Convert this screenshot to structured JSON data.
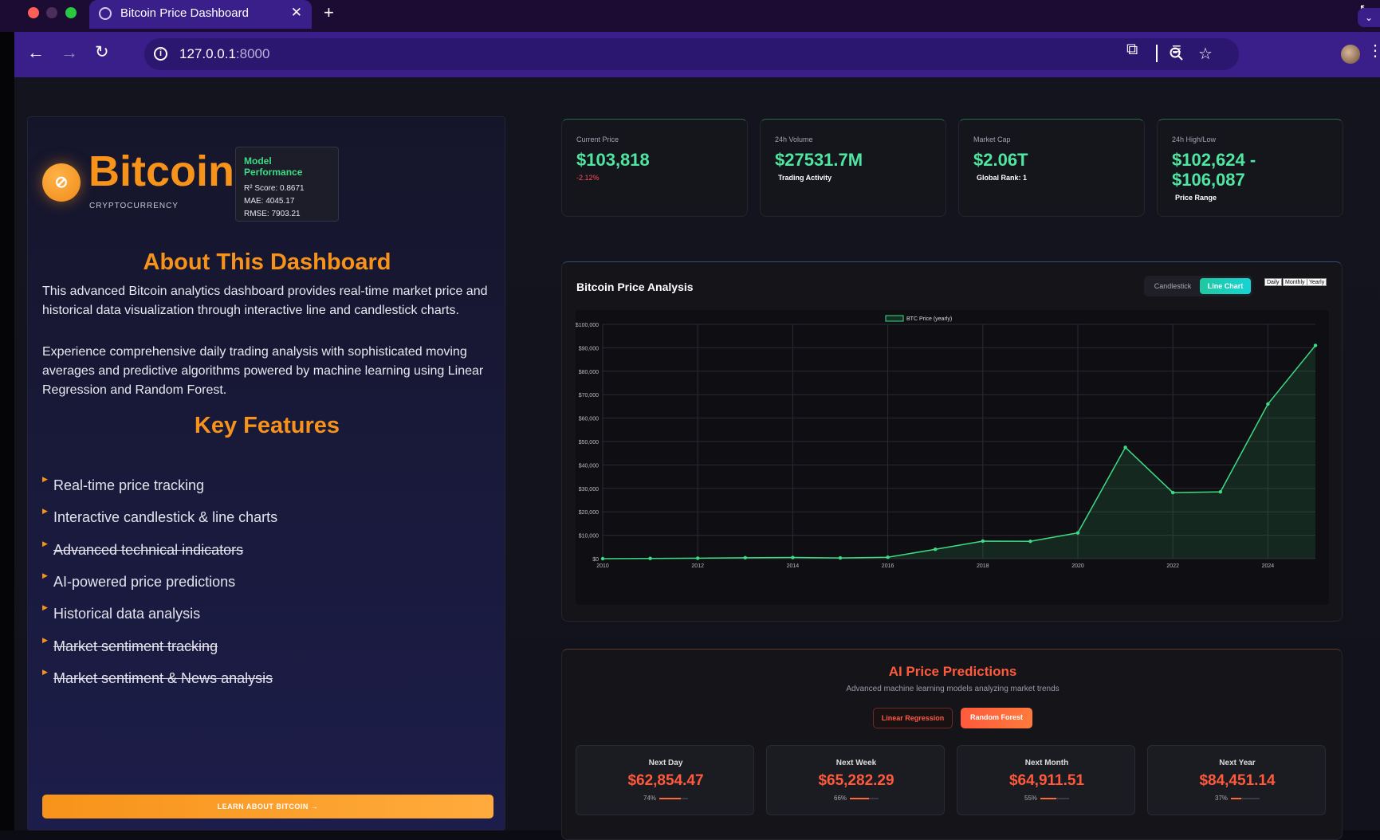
{
  "browser": {
    "tab_title": "Bitcoin Price Dashboard",
    "url_host": "127.0.0.1",
    "url_port": ":8000"
  },
  "sidebar": {
    "coin_name": "Bitcoin",
    "coin_subtitle": "CRYPTOCURRENCY",
    "model_performance": {
      "title": "Model Performance",
      "r2": "R² Score: 0.8671",
      "mae": "MAE: 4045.17",
      "rmse": "RMSE: 7903.21"
    },
    "about_title": "About This Dashboard",
    "about_p1": "This advanced Bitcoin analytics dashboard provides real-time market price and historical data visualization through interactive line and candlestick charts.",
    "about_p2": "Experience comprehensive daily trading analysis with sophisticated moving averages and predictive algorithms powered by machine learning using Linear Regression and Random Forest.",
    "features_title": "Key Features",
    "features": [
      {
        "label": "Real-time price tracking",
        "struck": false
      },
      {
        "label": "Interactive candlestick & line charts",
        "struck": false
      },
      {
        "label": "Advanced technical indicators",
        "struck": true
      },
      {
        "label": "AI-powered price predictions",
        "struck": false
      },
      {
        "label": "Historical data analysis",
        "struck": false
      },
      {
        "label": "Market sentiment tracking",
        "struck": true
      },
      {
        "label": "Market sentiment & News analysis",
        "struck": true
      }
    ],
    "learn_button": "LEARN ABOUT BITCOIN →"
  },
  "stats": [
    {
      "label": "Current Price",
      "value": "$103,818",
      "sub": "-2.12%",
      "sub_negative": true
    },
    {
      "label": "24h Volume",
      "value": "$27531.7M",
      "sub": "Trading Activity",
      "sub_negative": false
    },
    {
      "label": "Market Cap",
      "value": "$2.06T",
      "sub": "Global Rank: 1",
      "sub_negative": false
    },
    {
      "label": "24h High/Low",
      "value": "$102,624 - $106,087",
      "sub": "Price Range",
      "sub_negative": false
    }
  ],
  "chart_panel": {
    "title": "Bitcoin Price Analysis",
    "toggle": [
      "Candlestick",
      "Line Chart"
    ],
    "toggle_active": "Line Chart",
    "ranges": [
      "Daily",
      "Monthly",
      "Yearly"
    ]
  },
  "chart_data": {
    "type": "line",
    "title": "",
    "xlabel": "",
    "ylabel": "",
    "series": [
      {
        "name": "BTC Price (yearly)",
        "x": [
          2010,
          2011,
          2012,
          2013,
          2014,
          2015,
          2016,
          2017,
          2018,
          2019,
          2020,
          2021,
          2022,
          2023,
          2024,
          2025
        ],
        "values": [
          0,
          100,
          200,
          400,
          500,
          300,
          600,
          4000,
          7500,
          7400,
          11000,
          47500,
          28200,
          28500,
          66000,
          91000
        ]
      }
    ],
    "x_ticks": [
      "2010",
      "2012",
      "2014",
      "2016",
      "2018",
      "2020",
      "2022",
      "2024"
    ],
    "y_ticks": [
      "$0",
      "$10,000",
      "$20,000",
      "$30,000",
      "$40,000",
      "$50,000",
      "$60,000",
      "$70,000",
      "$80,000",
      "$90,000",
      "$100,000"
    ],
    "xlim": [
      2010,
      2025
    ],
    "ylim": [
      0,
      100000
    ],
    "grid": true,
    "legend": "top-center",
    "line_color": "#3ddc84"
  },
  "predictions": {
    "title": "AI Price Predictions",
    "subtitle": "Advanced machine learning models analyzing market trends",
    "models": [
      "Linear Regression",
      "Random Forest"
    ],
    "active_model": "Random Forest",
    "cards": [
      {
        "label": "Next Day",
        "value": "$62,854.47",
        "confidence": "74%",
        "level": 0.74
      },
      {
        "label": "Next Week",
        "value": "$65,282.29",
        "confidence": "66%",
        "level": 0.66
      },
      {
        "label": "Next Month",
        "value": "$64,911.51",
        "confidence": "55%",
        "level": 0.55
      },
      {
        "label": "Next Year",
        "value": "$84,451.14",
        "confidence": "37%",
        "level": 0.37
      }
    ]
  }
}
